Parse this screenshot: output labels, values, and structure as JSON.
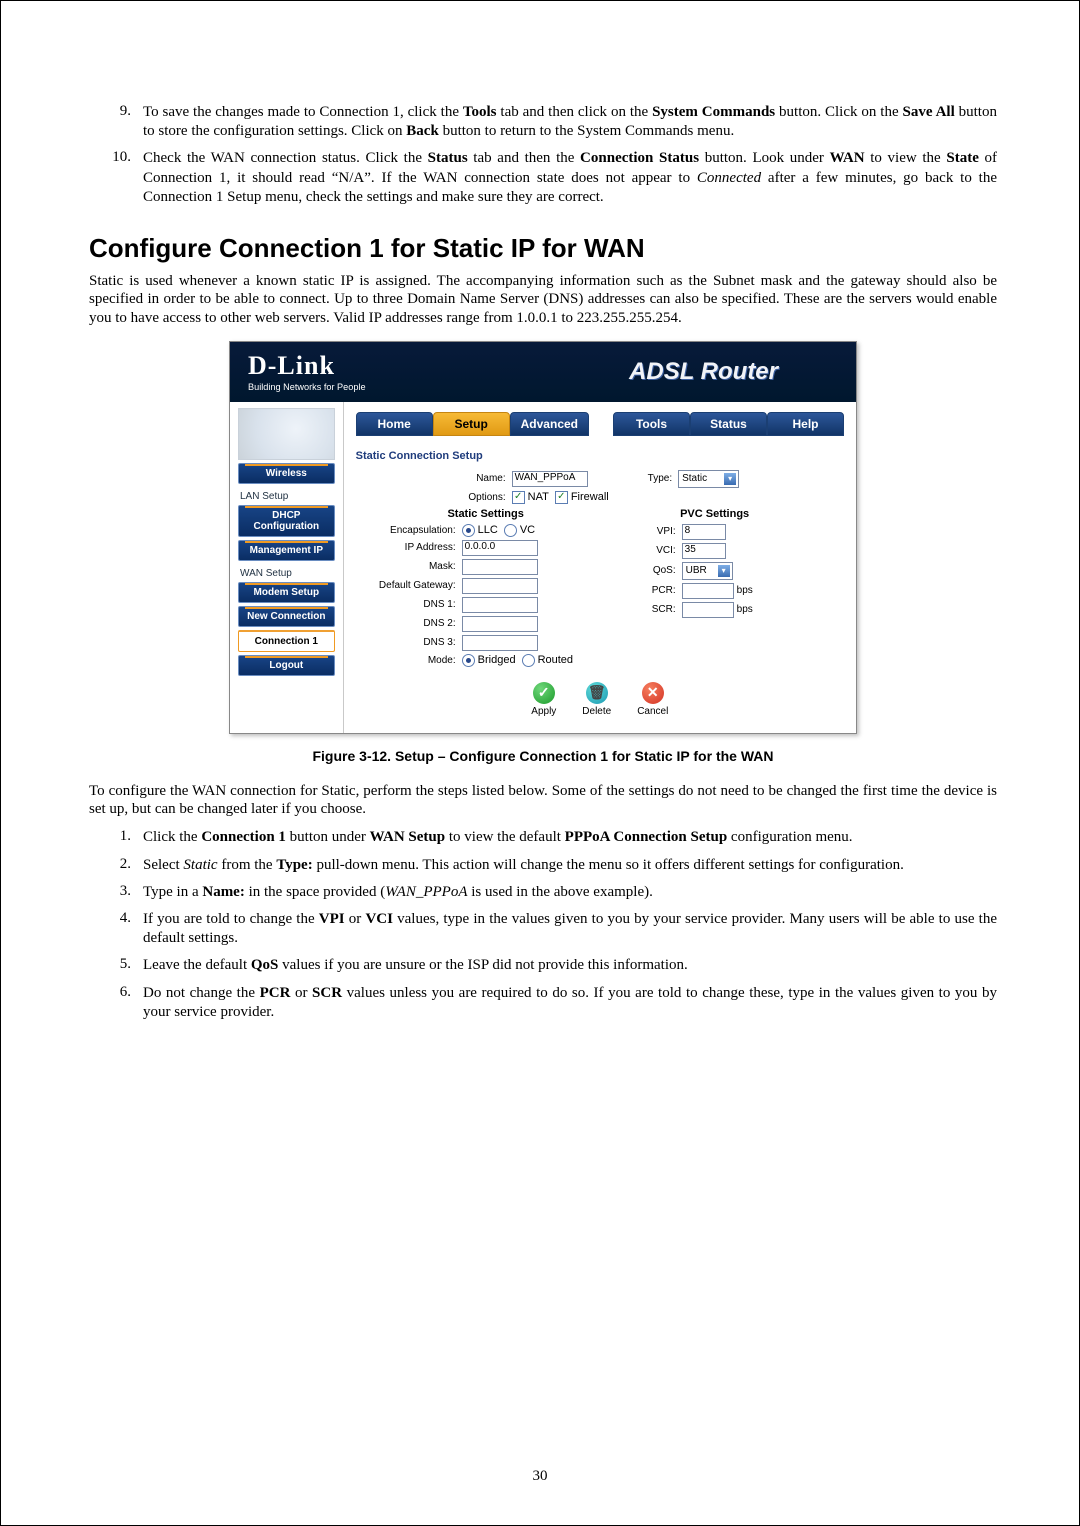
{
  "list_top": [
    {
      "num": "9.",
      "html_parts": [
        "To save the changes made to Connection 1, click the ",
        {
          "b": "Tools"
        },
        " tab and then click on the ",
        {
          "b": "System Commands"
        },
        " button. Click on the ",
        {
          "b": "Save All"
        },
        " button to store the configuration settings. Click on ",
        {
          "b": "Back"
        },
        " button to return to the System Commands menu."
      ]
    },
    {
      "num": "10.",
      "html_parts": [
        "Check the WAN connection status. Click the ",
        {
          "b": "Status"
        },
        " tab and then the ",
        {
          "b": "Connection Status"
        },
        " button. Look under ",
        {
          "b": "WAN"
        },
        " to view the ",
        {
          "b": "State"
        },
        " of Connection 1, it should read  “N/A”. If the WAN connection state does not appear to ",
        {
          "i": "Connected"
        },
        " after a few minutes, go back to the Connection 1 Setup menu, check the settings and make sure they are correct."
      ]
    }
  ],
  "heading": "Configure Connection 1 for Static IP for WAN",
  "intro": "Static is used whenever a known static IP is assigned. The accompanying information such as the Subnet mask and the gateway should also be specified in order to be able to connect. Up to three Domain Name Server (DNS) addresses can also be specified. These are the servers would enable you to have access to other web servers. Valid IP addresses range from 1.0.0.1 to 223.255.255.254.",
  "router": {
    "brand": "D-Link",
    "brand_tag": "Building Networks for People",
    "title": "ADSL Router",
    "tabs": [
      "Home",
      "Setup",
      "Advanced",
      "Tools",
      "Status",
      "Help"
    ],
    "active_tab": 1,
    "side": {
      "wireless": "Wireless",
      "lan_setup": "LAN Setup",
      "dhcp": "DHCP Configuration",
      "mgmt_ip": "Management IP",
      "wan_setup": "WAN Setup",
      "modem": "Modem Setup",
      "new_conn": "New Connection",
      "conn1": "Connection 1",
      "logout": "Logout"
    },
    "panel": {
      "title": "Static Connection Setup",
      "name_label": "Name:",
      "name_value": "WAN_PPPoA",
      "type_label": "Type:",
      "type_value": "Static",
      "options_label": "Options:",
      "nat_label": "NAT",
      "firewall_label": "Firewall",
      "static_heading": "Static Settings",
      "encap_label": "Encapsulation:",
      "encap_llc": "LLC",
      "encap_vc": "VC",
      "ip_label": "IP Address:",
      "ip_value": "0.0.0.0",
      "mask_label": "Mask:",
      "gw_label": "Default Gateway:",
      "dns1_label": "DNS 1:",
      "dns2_label": "DNS 2:",
      "dns3_label": "DNS 3:",
      "mode_label": "Mode:",
      "mode_bridged": "Bridged",
      "mode_routed": "Routed",
      "pvc_heading": "PVC Settings",
      "vpi_label": "VPI:",
      "vpi_value": "8",
      "vci_label": "VCI:",
      "vci_value": "35",
      "qos_label": "QoS:",
      "qos_value": "UBR",
      "pcr_label": "PCR:",
      "scr_label": "SCR:",
      "bps": "bps",
      "apply": "Apply",
      "delete": "Delete",
      "cancel": "Cancel"
    }
  },
  "figure_caption": "Figure 3-12. Setup – Configure Connection 1 for Static IP for the WAN",
  "intro2": "To configure the WAN connection for Static, perform the steps listed below. Some of the settings do not need to be changed the first time the device is set up, but can be changed later if you choose.",
  "list_bottom": [
    {
      "num": "1.",
      "html_parts": [
        "Click the ",
        {
          "b": "Connection 1"
        },
        " button under ",
        {
          "b": "WAN Setup"
        },
        " to view the default ",
        {
          "b": "PPPoA Connection Setup"
        },
        " configuration menu."
      ]
    },
    {
      "num": "2.",
      "html_parts": [
        "Select ",
        {
          "i": "Static"
        },
        " from the ",
        {
          "b": "Type:"
        },
        " pull-down menu. This action will change the menu so it offers different settings for configuration."
      ]
    },
    {
      "num": "3.",
      "html_parts": [
        "Type in a ",
        {
          "b": "Name:"
        },
        " in the space provided (",
        {
          "i": "WAN_PPPoA"
        },
        " is used in the above example)."
      ]
    },
    {
      "num": "4.",
      "html_parts": [
        "If you are told to change the ",
        {
          "b": "VPI"
        },
        " or ",
        {
          "b": "VCI"
        },
        " values, type in the values given to you by your service provider. Many users will be able to use the default settings."
      ]
    },
    {
      "num": "5.",
      "html_parts": [
        "Leave the default ",
        {
          "b": "QoS"
        },
        " values if you are unsure or the ISP did not provide this information."
      ]
    },
    {
      "num": "6.",
      "html_parts": [
        "Do not change the ",
        {
          "b": "PCR"
        },
        " or ",
        {
          "b": "SCR"
        },
        " values unless you are required to do so. If you are told to change these, type in the values given to you by your service provider."
      ]
    }
  ],
  "page_number": "30"
}
